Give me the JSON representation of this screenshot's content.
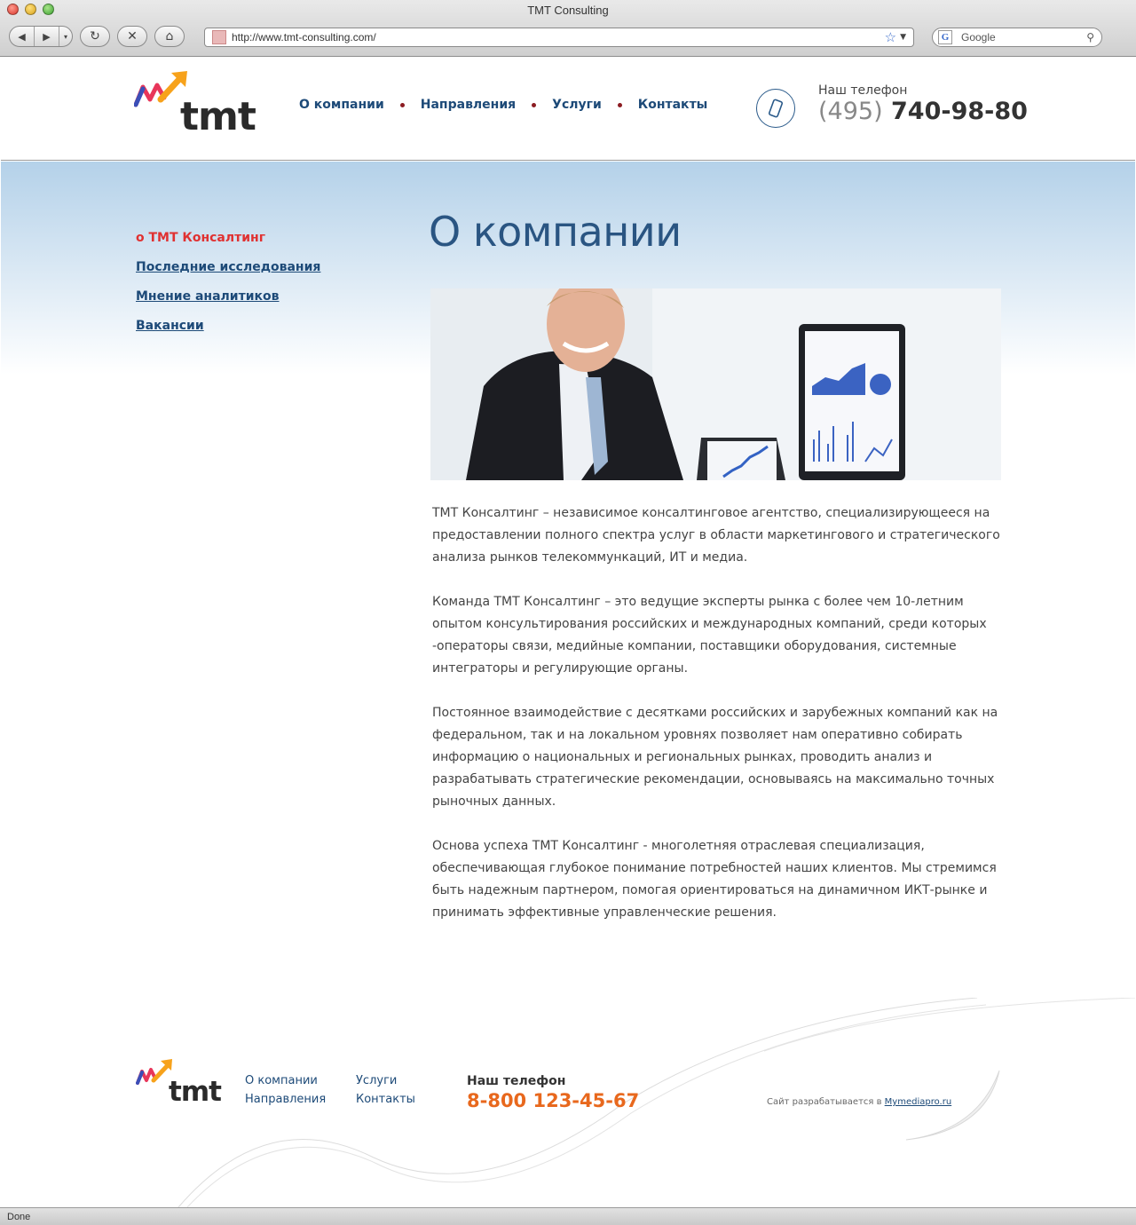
{
  "browser": {
    "window_title": "TMT Consulting",
    "url": "http://www.tmt-consulting.com/",
    "search_placeholder": "Google",
    "status_text": "Done"
  },
  "header": {
    "logo_text": "tmt",
    "nav": [
      "О компании",
      "Направления",
      "Услуги",
      "Контакты"
    ],
    "phone_label": "Наш телефон",
    "phone_code": "(495)",
    "phone_number": "740-98-80"
  },
  "sidebar": {
    "items": [
      {
        "label": "о ТМТ Консалтинг",
        "active": true
      },
      {
        "label": "Последние исследования",
        "active": false
      },
      {
        "label": "Мнение аналитиков",
        "active": false
      },
      {
        "label": "Вакансии",
        "active": false
      }
    ]
  },
  "main": {
    "title": "О компании",
    "paragraphs": [
      "ТМТ Консалтинг – независимое консалтинговое агентство, специализирующееся на предоставлении полного спектра услуг в области маркетингового и стратегического анализа рынков телекоммункаций, ИТ и медиа.",
      "Команда ТМТ Консалтинг – это ведущие эксперты рынка с более чем 10-летним опытом консультирования российских и международных компаний, среди которых -операторы связи, медийные компании, поставщики оборудования, системные интеграторы и регулирующие органы.",
      "Постоянное взаимодействие с десятками российских и зарубежных компаний как на федеральном, так и на локальном уровнях позволяет нам оперативно собирать информацию о национальных и региональных рынках, проводить анализ и разрабатывать стратегические рекомендации, основываясь на максимально точных рыночных данных.",
      "Основа успеха ТМТ Консалтинг - многолетняя отраслевая специализация, обеспечивающая глубокое понимание потребностей наших клиентов. Мы стремимся быть надежным партнером, помогая  ориентироваться на динамичном ИКТ-рынке и принимать эффективные управленческие решения."
    ]
  },
  "footer": {
    "logo_text": "tmt",
    "links": [
      "О компании",
      "Услуги",
      "Направления",
      "Контакты"
    ],
    "phone_label": "Наш телефон",
    "phone_number": "8-800 123-45-67",
    "dev_text": "Сайт разрабатывается в ",
    "dev_link": "Mymediapro.ru"
  },
  "colors": {
    "nav_blue": "#1d4a78",
    "active_red": "#e03131",
    "footer_phone_orange": "#e8681d"
  }
}
